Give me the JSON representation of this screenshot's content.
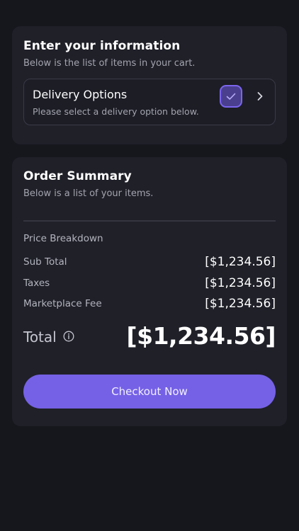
{
  "info_card": {
    "title": "Enter your information",
    "subtitle": "Below is the list of items in your cart.",
    "delivery": {
      "title": "Delivery Options",
      "subtitle": "Please select a delivery option below.",
      "checked": true,
      "check_icon": "check-icon",
      "chevron_icon": "chevron-right-icon"
    }
  },
  "summary_card": {
    "title": "Order Summary",
    "subtitle": "Below is a list of your items.",
    "breakdown_label": "Price Breakdown",
    "rows": [
      {
        "label": "Sub Total",
        "value": "[$1,234.56]"
      },
      {
        "label": "Taxes",
        "value": "[$1,234.56]"
      },
      {
        "label": "Marketplace Fee",
        "value": "[$1,234.56]"
      }
    ],
    "total": {
      "label": "Total",
      "info_icon": "info-icon",
      "value": "[$1,234.56]"
    },
    "checkout_label": "Checkout Now"
  },
  "colors": {
    "background": "#16171d",
    "card": "#1f2028",
    "accent": "#7561e6",
    "check_fill": "#4a3f8f",
    "check_border": "#7b65ee"
  }
}
